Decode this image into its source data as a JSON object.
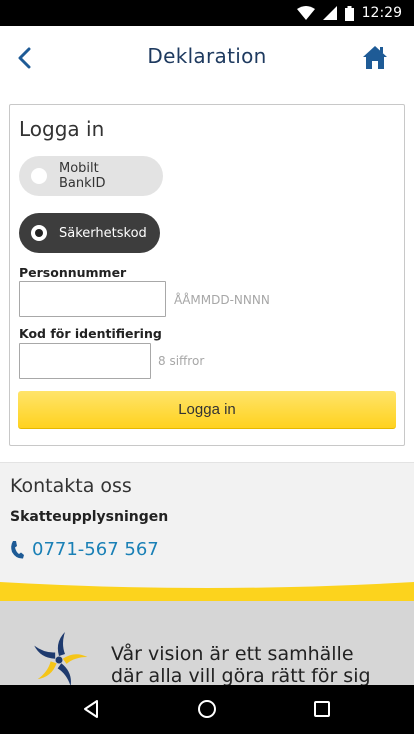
{
  "status_bar": {
    "time": "12:29",
    "icons": [
      "wifi-icon",
      "signal-icon",
      "battery-icon"
    ]
  },
  "header": {
    "title": "Deklaration",
    "back_icon": "chevron-left-icon",
    "home_icon": "home-icon"
  },
  "login": {
    "heading": "Logga in",
    "method_options": [
      {
        "label": "Mobilt BankID",
        "selected": false
      },
      {
        "label": "Säkerhetskod",
        "selected": true
      }
    ],
    "personnummer": {
      "label": "Personnummer",
      "value": "",
      "hint": "ÅÅMMDD-NNNN"
    },
    "kod": {
      "label": "Kod för identifiering",
      "value": "",
      "hint": "8 siffror"
    },
    "submit_label": "Logga in"
  },
  "contact": {
    "heading": "Kontakta oss",
    "subheading": "Skatteupplysningen",
    "phone": "0771-567 567",
    "phone_icon": "phone-icon"
  },
  "vision": {
    "line1": "Vår vision är ett samhälle",
    "line2": "där alla vill göra rätt för sig"
  },
  "nav_bar": {
    "buttons": [
      "back-triangle-icon",
      "home-circle-icon",
      "recents-square-icon"
    ]
  },
  "colors": {
    "title_blue": "#1e3a5f",
    "link_blue": "#1a80b6",
    "accent_yellow": "#ffd21f",
    "pill_dark": "#3d3d3d"
  }
}
